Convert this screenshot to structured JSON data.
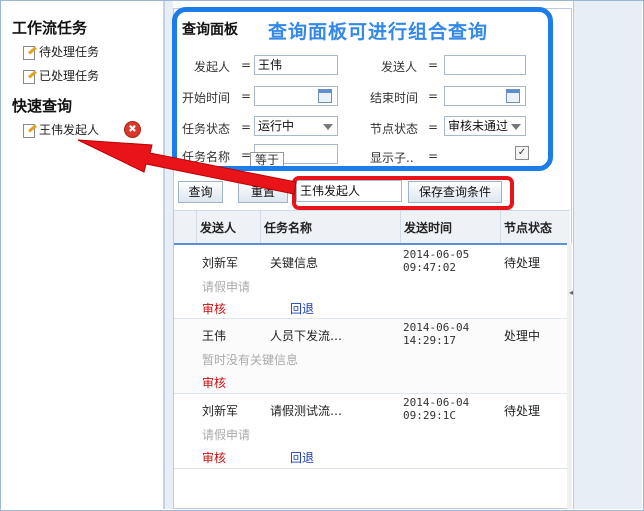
{
  "sidebar": {
    "workflow_title": "工作流任务",
    "pending_label": "待处理任务",
    "done_label": "已处理任务",
    "quick_title": "快速查询",
    "saved_query_label": "王伟发起人",
    "delete_icon": "✖"
  },
  "panel": {
    "title": "查询面板",
    "callout": "查询面板可进行组合查询",
    "fields": {
      "initiator_label": "发起人",
      "initiator_value": "王伟",
      "sender_label": "发送人",
      "sender_value": "",
      "start_label": "开始时间",
      "end_label": "结束时间",
      "status_label": "任务状态",
      "status_value": "运行中",
      "node_label": "节点状态",
      "node_value": "审核未通过",
      "name_label": "任务名称",
      "name_value": "",
      "show_label": "显示子..",
      "show_checked": "✓",
      "eq": "="
    },
    "tooltip": "等于",
    "query_button": "查询",
    "reset_button": "重置",
    "save_name_value": "王伟发起人",
    "save_button": "保存查询条件"
  },
  "table": {
    "headers": [
      "发送人",
      "任务名称",
      "发送时间",
      "节点状态"
    ],
    "rows": [
      {
        "sender": "刘新军",
        "name": "关键信息",
        "date": "2014-06-05",
        "time": "09:47:02",
        "status": "待处理",
        "desc": "请假申请",
        "act1": "审核",
        "act2": "回退"
      },
      {
        "sender": "王伟",
        "name": "人员下发流…",
        "date": "2014-06-04",
        "time": "14:29:17",
        "status": "处理中",
        "desc": "暂时没有关键信息",
        "act1": "审核",
        "act2": ""
      },
      {
        "sender": "刘新军",
        "name": "请假测试流…",
        "date": "2014-06-04",
        "time": "09:29:1C",
        "status": "待处理",
        "desc": "请假申请",
        "act1": "审核",
        "act2": "回退"
      }
    ]
  },
  "colors": {
    "accent_blue": "#1d7de8",
    "accent_red": "#e8141a",
    "callout_text": "#3388e8"
  }
}
